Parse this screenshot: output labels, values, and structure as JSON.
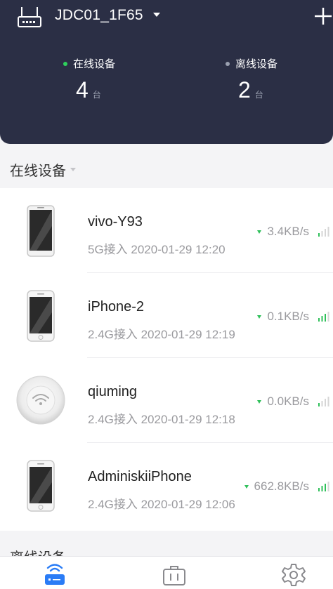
{
  "header": {
    "router_name": "JDC01_1F65",
    "icons": {
      "router": "router-icon",
      "dropdown": "caret-down-icon",
      "add": "plus-icon"
    },
    "online": {
      "label": "在线设备",
      "count": "4",
      "unit": "台"
    },
    "offline": {
      "label": "离线设备",
      "count": "2",
      "unit": "台"
    }
  },
  "online_section": {
    "title": "在线设备"
  },
  "devices": [
    {
      "name": "vivo-Y93",
      "meta": "5G接入 2020-01-29 12:20",
      "speed": "3.4KB/s",
      "icon": "phone-icon"
    },
    {
      "name": "iPhone-2",
      "meta": "2.4G接入 2020-01-29 12:19",
      "speed": "0.1KB/s",
      "icon": "iphone-icon"
    },
    {
      "name": "qiuming",
      "meta": "2.4G接入 2020-01-29 12:18",
      "speed": "0.0KB/s",
      "icon": "wifi-device-icon"
    },
    {
      "name": "AdminiskiiPhone",
      "meta": "2.4G接入 2020-01-29 12:06",
      "speed": "662.8KB/s",
      "icon": "iphone-icon"
    }
  ],
  "offline_section": {
    "title": "离线设备"
  },
  "tabs": [
    {
      "icon": "router-wifi-icon",
      "active": true
    },
    {
      "icon": "toolbox-icon",
      "active": false
    },
    {
      "icon": "settings-gear-icon",
      "active": false
    }
  ],
  "colors": {
    "header_bg": "#2b2f45",
    "online_dot": "#2fd15c",
    "accent_blue": "#2a7cf6",
    "signal_green": "#2fc05a"
  }
}
